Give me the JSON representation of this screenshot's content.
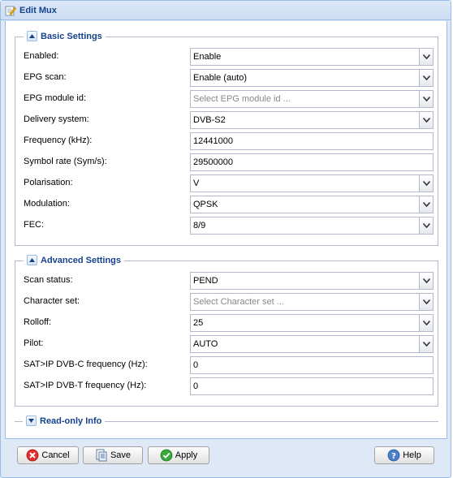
{
  "window": {
    "title": "Edit Mux"
  },
  "basic": {
    "legend": "Basic Settings",
    "rows": [
      {
        "label": "Enabled:",
        "value": "Enable",
        "type": "combo"
      },
      {
        "label": "EPG scan:",
        "value": "Enable (auto)",
        "type": "combo"
      },
      {
        "label": "EPG module id:",
        "value": "",
        "placeholder": "Select EPG module id ...",
        "type": "combo"
      },
      {
        "label": "Delivery system:",
        "value": "DVB-S2",
        "type": "combo"
      },
      {
        "label": "Frequency (kHz):",
        "value": "12441000",
        "type": "text"
      },
      {
        "label": "Symbol rate (Sym/s):",
        "value": "29500000",
        "type": "text"
      },
      {
        "label": "Polarisation:",
        "value": "V",
        "type": "combo"
      },
      {
        "label": "Modulation:",
        "value": "QPSK",
        "type": "combo"
      },
      {
        "label": "FEC:",
        "value": "8/9",
        "type": "combo"
      }
    ]
  },
  "advanced": {
    "legend": "Advanced Settings",
    "rows": [
      {
        "label": "Scan status:",
        "value": "PEND",
        "type": "combo"
      },
      {
        "label": "Character set:",
        "value": "",
        "placeholder": "Select Character set ...",
        "type": "combo"
      },
      {
        "label": "Rolloff:",
        "value": "25",
        "type": "combo"
      },
      {
        "label": "Pilot:",
        "value": "AUTO",
        "type": "combo"
      },
      {
        "label": "SAT>IP DVB-C frequency (Hz):",
        "value": "0",
        "type": "text"
      },
      {
        "label": "SAT>IP DVB-T frequency (Hz):",
        "value": "0",
        "type": "text"
      }
    ]
  },
  "readonly": {
    "legend": "Read-only Info"
  },
  "buttons": {
    "cancel": "Cancel",
    "save": "Save",
    "apply": "Apply",
    "help": "Help"
  },
  "icons": {
    "title": "edit-icon",
    "collapse": "collapse-icon",
    "expand": "expand-icon",
    "dropdown": "chevron-down-icon",
    "cancel": "cancel-icon",
    "save": "save-icon",
    "apply": "apply-icon",
    "help": "help-icon"
  },
  "colors": {
    "header_text": "#15428b",
    "border": "#99bbe8",
    "window_bg": "#dfe8f6"
  }
}
